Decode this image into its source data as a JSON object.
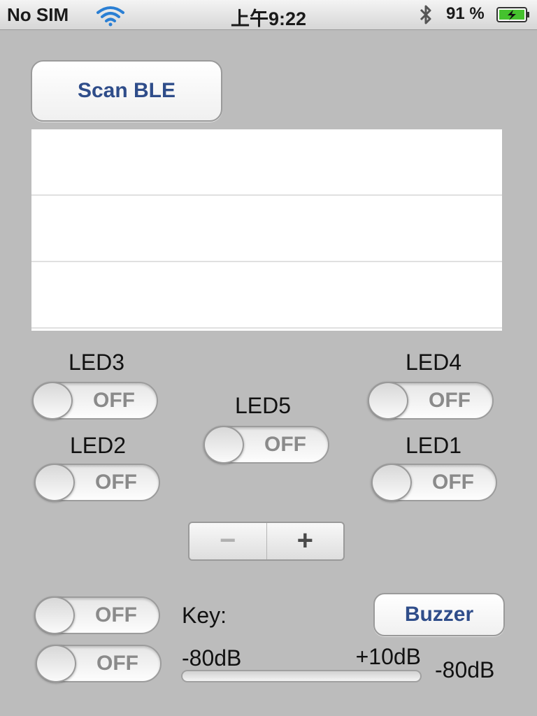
{
  "status_bar": {
    "carrier": "No SIM",
    "time": "上午9:22",
    "battery_percent": "91 %",
    "wifi_icon": "wifi-icon",
    "bluetooth_icon": "bluetooth-icon",
    "battery_icon": "battery-charging-icon"
  },
  "scan_button": {
    "label": "Scan BLE"
  },
  "device_table": {
    "rows": [
      "",
      "",
      ""
    ]
  },
  "leds": {
    "led3": {
      "label": "LED3",
      "state": "OFF"
    },
    "led4": {
      "label": "LED4",
      "state": "OFF"
    },
    "led5": {
      "label": "LED5",
      "state": "OFF"
    },
    "led2": {
      "label": "LED2",
      "state": "OFF"
    },
    "led1": {
      "label": "LED1",
      "state": "OFF"
    }
  },
  "stepper": {
    "minus": "−",
    "plus": "+"
  },
  "bottom": {
    "switch_a": {
      "state": "OFF"
    },
    "switch_b": {
      "state": "OFF"
    },
    "key_label": "Key:",
    "buzzer_label": "Buzzer",
    "slider_min": "-80dB",
    "slider_max": "+10dB",
    "slider_value": "-80dB",
    "slider_fraction": 0
  },
  "colors": {
    "accent": "#2f4d8a",
    "background": "#bcbcbc",
    "battery_fill": "#45c22e"
  }
}
